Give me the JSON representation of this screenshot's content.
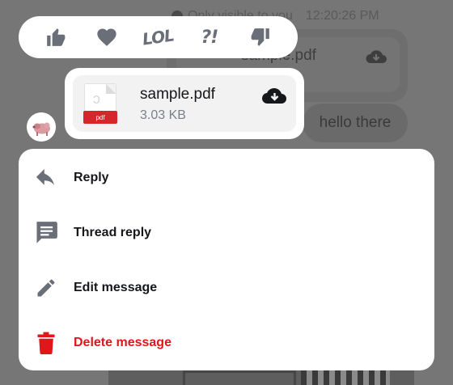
{
  "background": {
    "visibility_note": "Only visible to you",
    "timestamp": "12:20:26 PM",
    "file_name": "sample.pdf",
    "greeting": "hello there"
  },
  "reactions": [
    {
      "name": "thumbs-up-icon"
    },
    {
      "name": "heart-icon"
    },
    {
      "name": "lol-icon",
      "glyph": "LOL"
    },
    {
      "name": "surprised-icon",
      "glyph": "?!"
    },
    {
      "name": "thumbs-down-icon"
    }
  ],
  "message": {
    "file_name": "sample.pdf",
    "file_size": "3.03 KB",
    "file_type_badge": "pdf"
  },
  "actions": [
    {
      "label": "Reply",
      "icon": "reply-icon"
    },
    {
      "label": "Thread reply",
      "icon": "thread-icon"
    },
    {
      "label": "Edit message",
      "icon": "pencil-icon"
    },
    {
      "label": "Delete message",
      "icon": "trash-icon"
    }
  ],
  "colors": {
    "accent_danger": "#e0161b",
    "icon_gray": "#6a6e78",
    "overlay": "#767676",
    "pdf_badge": "#d7262b"
  }
}
